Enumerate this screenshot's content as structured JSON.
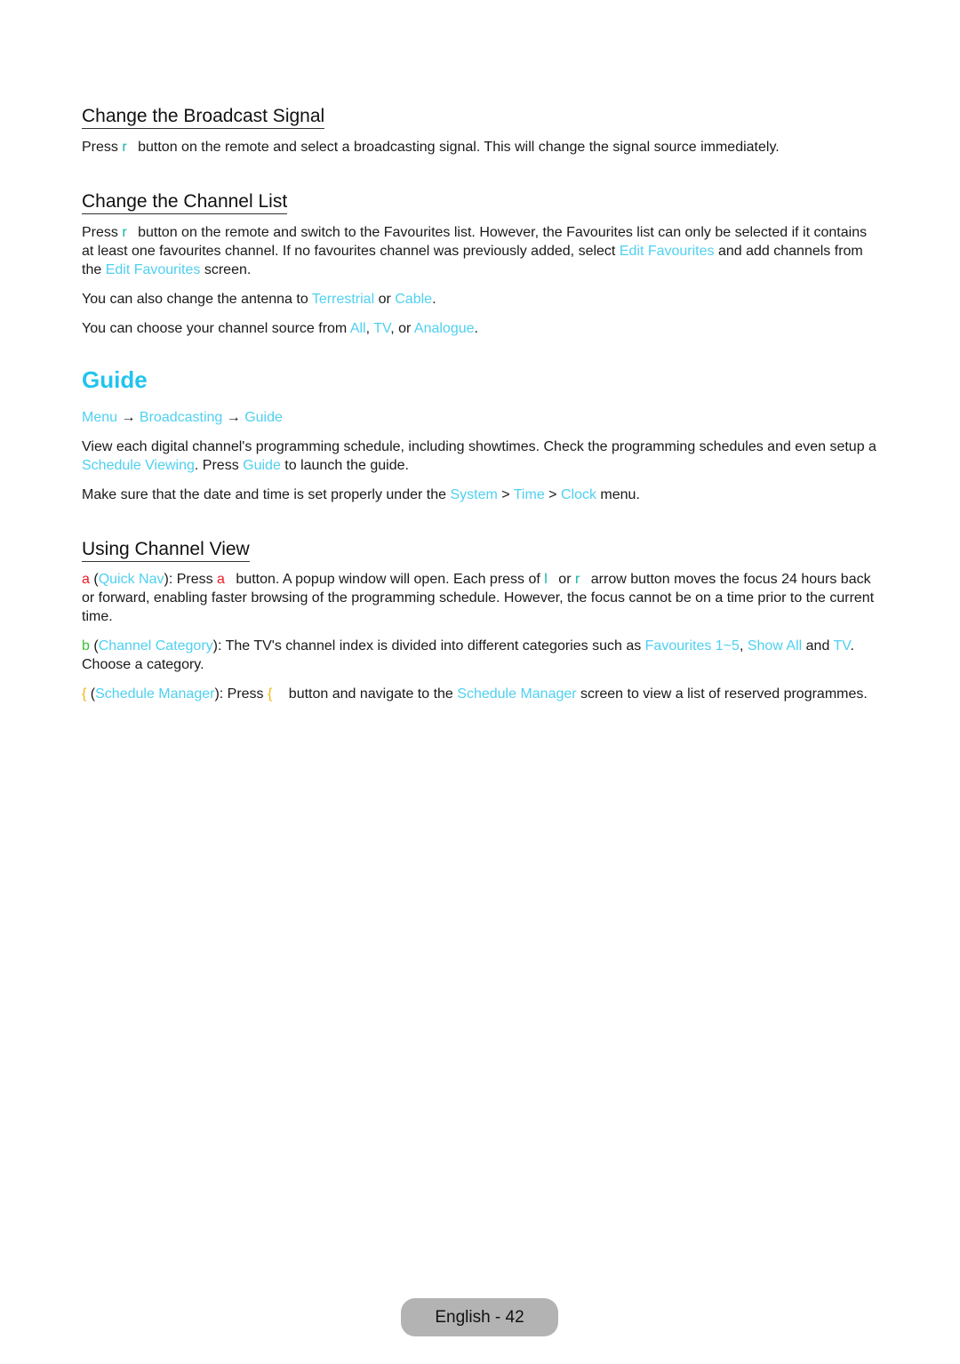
{
  "section_broadcast": {
    "heading": "Change the Broadcast Signal",
    "p1": {
      "pre": "Press ",
      "key": "r",
      "post": " button on the remote and select a broadcasting signal. This will change the signal source immediately."
    }
  },
  "section_channel_list": {
    "heading": "Change the Channel List",
    "p1": {
      "pre": "Press ",
      "key": "r",
      "mid1": " button on the remote and switch to the Favourites list. However, the Favourites list can only be selected if it contains at least one favourites channel. If no favourites channel was previously added, select ",
      "link1": "Edit Favourites",
      "mid2": " and add channels from the ",
      "link2": "Edit Favourites",
      "post": " screen."
    },
    "p2": {
      "pre": "You can also change the antenna to ",
      "link1": "Terrestrial",
      "mid": " or ",
      "link2": "Cable",
      "post": "."
    },
    "p3": {
      "pre": "You can choose your channel source from ",
      "link1": "All",
      "sep1": ", ",
      "link2": "TV",
      "sep2": ", or ",
      "link3": "Analogue",
      "post": "."
    }
  },
  "section_guide": {
    "title": "Guide",
    "breadcrumb": {
      "items": [
        "Menu",
        "Broadcasting",
        "Guide"
      ],
      "separator": " → "
    },
    "p1": {
      "pre": "View each digital channel's programming schedule, including showtimes. Check the programming schedules and even setup a ",
      "link1": "Schedule Viewing",
      "mid": ". Press ",
      "link2": "Guide",
      "post": " to launch the guide."
    },
    "p2": {
      "pre": "Make sure that the date and time is set properly under the ",
      "link1": "System",
      "sep1": " > ",
      "link2": "Time",
      "sep2": " > ",
      "link3": "Clock",
      "post": " menu."
    }
  },
  "section_channel_view": {
    "heading": "Using Channel View",
    "item_a": {
      "key": "a",
      "open": " (",
      "link1": "Quick Nav",
      "mid1": "): Press ",
      "key2": "a",
      "mid2": " button. A popup window will open. Each press of ",
      "key3": "l",
      "mid3": " or ",
      "key4": "r",
      "post": " arrow button moves the focus 24 hours back or forward, enabling faster browsing of the programming schedule. However, the focus cannot be on a time prior to the current time."
    },
    "item_b": {
      "key": "b",
      "open": " (",
      "link1": "Channel Category",
      "mid1": "): The TV's channel index is divided into different categories such as ",
      "link2": "Favourites 1~5",
      "sep": ", ",
      "link3": "Show All",
      "mid2": " and ",
      "link4": "TV",
      "post": ". Choose a category."
    },
    "item_c": {
      "key": "{",
      "open": " (",
      "link1": "Schedule Manager",
      "mid1": "): Press ",
      "key2": "{",
      "mid2": " button and navigate to the ",
      "link2": "Schedule Manager",
      "post": " screen to view a list of reserved programmes."
    }
  },
  "footer": {
    "page_label": "English - 42"
  },
  "colors": {
    "accent": "#22c3ee",
    "link": "#4fd0f0",
    "key_teal": "#17b3a3",
    "key_red": "#ee1c25",
    "key_green": "#35c435",
    "key_yellow": "#f6b40e",
    "footer_bg": "#b3b3b3"
  }
}
